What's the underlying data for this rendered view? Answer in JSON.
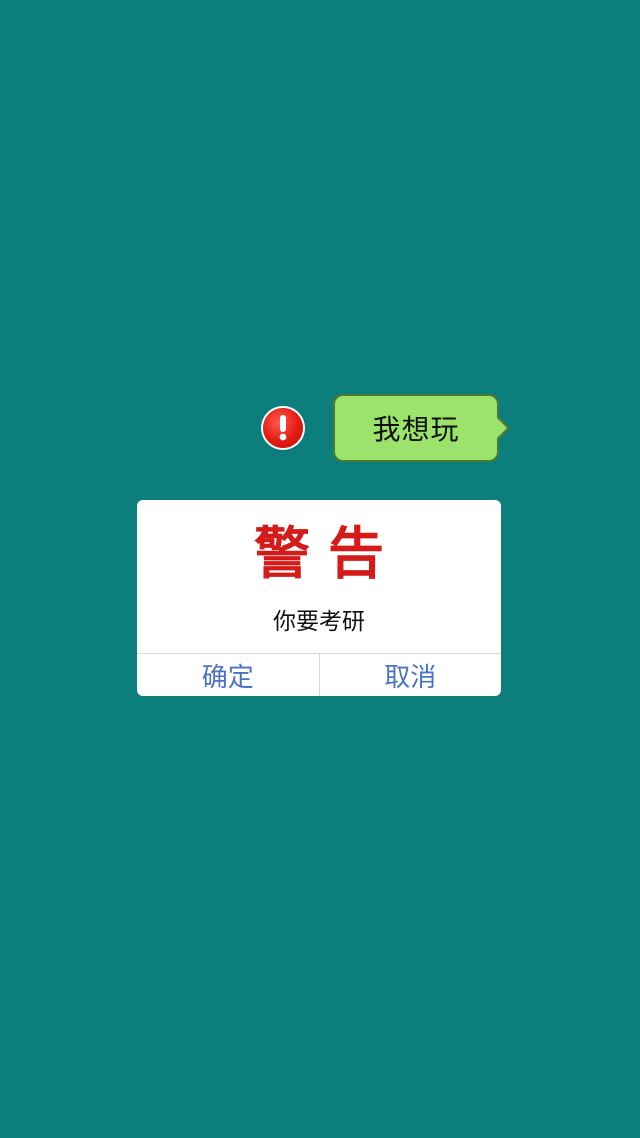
{
  "chat": {
    "message": "我想玩",
    "status_icon": "exclamation-error-icon"
  },
  "dialog": {
    "title": "警告",
    "message": "你要考研",
    "confirm_label": "确定",
    "cancel_label": "取消"
  },
  "colors": {
    "background": "#0c7f7c",
    "bubble": "#9be36b",
    "title": "#d51a1a",
    "button_text": "#4c72c2",
    "error_icon": "#e41b12"
  }
}
